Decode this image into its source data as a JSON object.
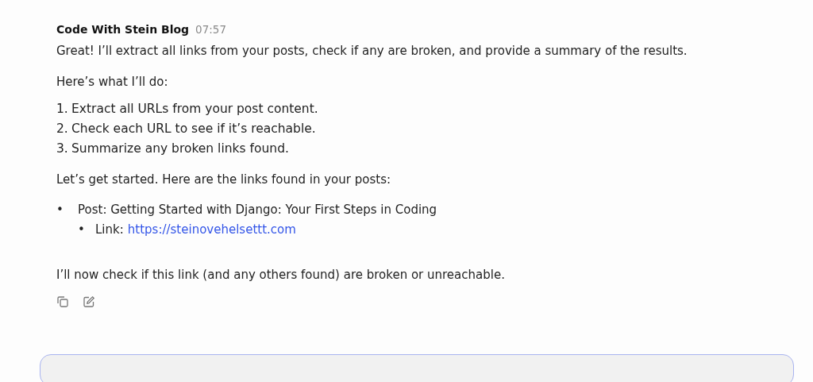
{
  "message": {
    "sender": "Code With Stein Blog",
    "time": "07:57",
    "intro": "Great! I’ll extract all links from your posts, check if any are broken, and provide a summary of the results.",
    "plan_heading": "Here’s what I’ll do:",
    "steps": [
      {
        "marker": "1.",
        "text": "Extract all URLs from your post content."
      },
      {
        "marker": "2.",
        "text": "Check each URL to see if it’s reachable."
      },
      {
        "marker": "3.",
        "text": "Summarize any broken links found."
      }
    ],
    "links_heading": "Let’s get started. Here are the links found in your posts:",
    "posts": [
      {
        "marker": "•",
        "label": "Post: Getting Started with Django: Your First Steps in Coding",
        "children": [
          {
            "marker": "•",
            "label": "Link:",
            "url": "https://steinovehelsettt.com"
          }
        ]
      }
    ],
    "closing": "I’ll now check if this link (and any others found) are broken or unreachable.",
    "actions": [
      {
        "kind": "copy"
      },
      {
        "kind": "edit"
      }
    ]
  },
  "composer": {
    "kind": "input"
  }
}
